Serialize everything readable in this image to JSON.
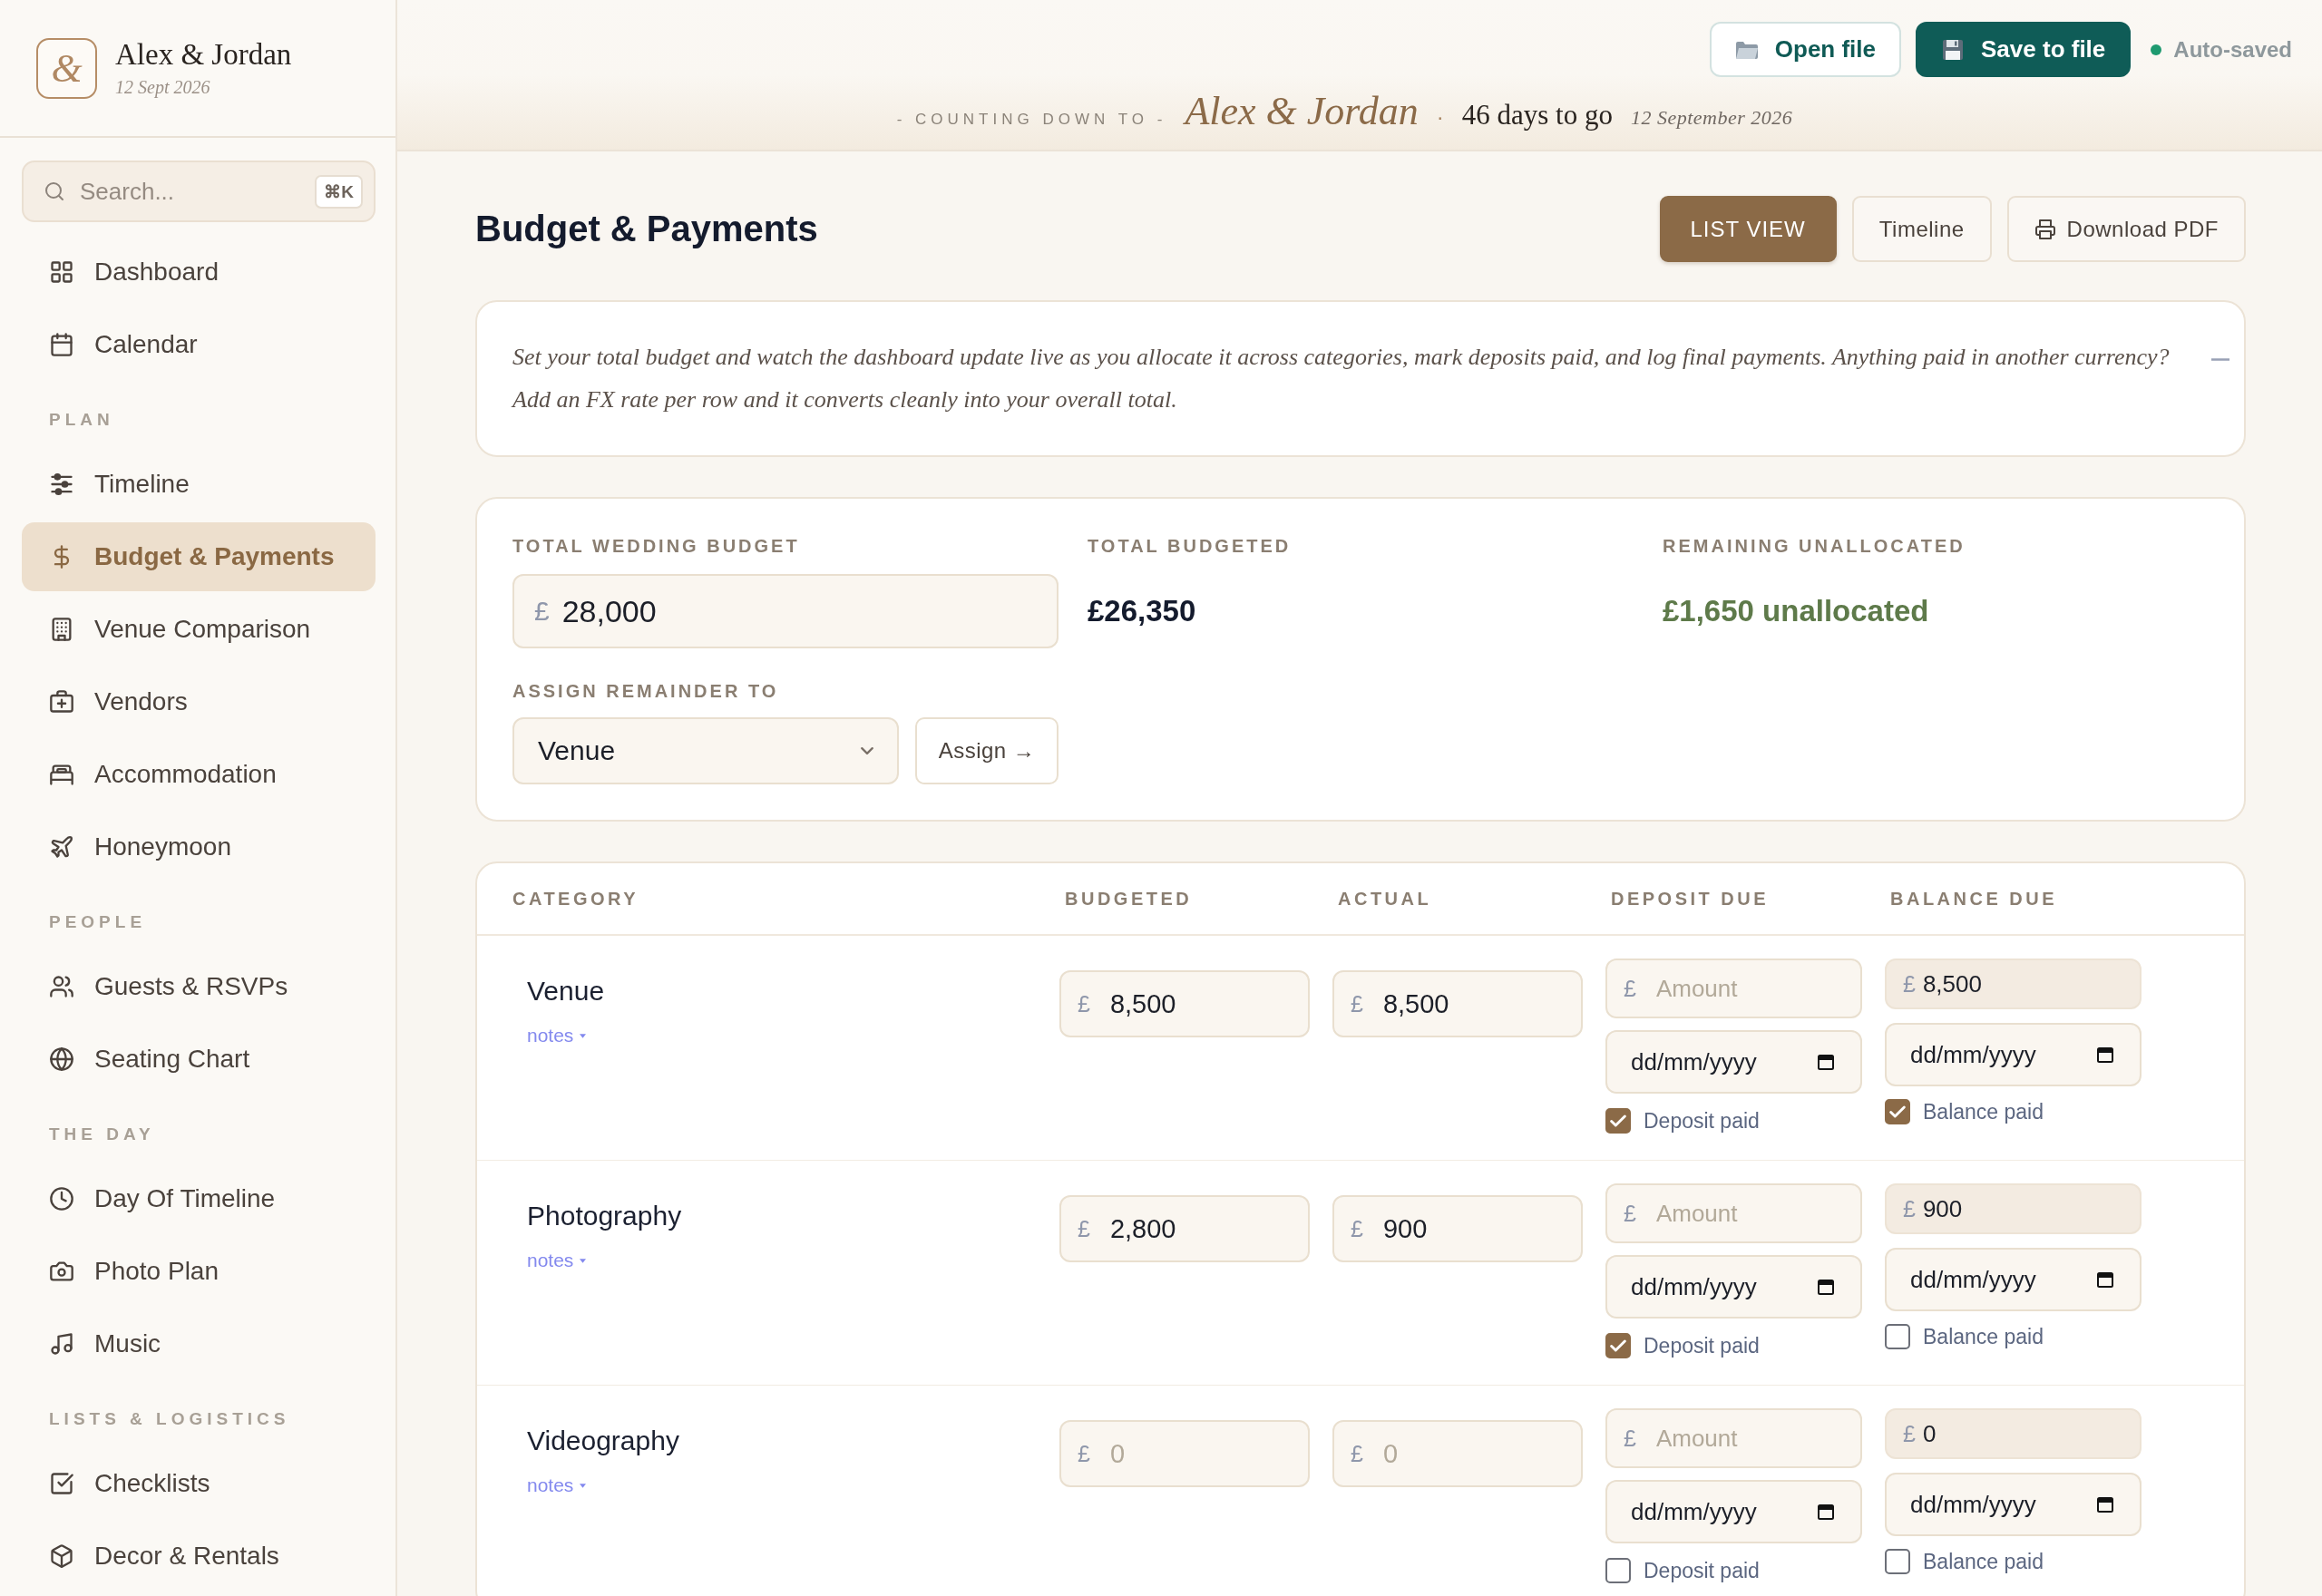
{
  "sidebar": {
    "brand": {
      "monogram": "&",
      "title": "Alex & Jordan",
      "date": "12 Sept 2026"
    },
    "search": {
      "placeholder": "Search...",
      "shortcut": "⌘K"
    },
    "sections": [
      {
        "items": [
          {
            "label": "Dashboard",
            "selected": false
          },
          {
            "label": "Calendar",
            "selected": false
          }
        ]
      },
      {
        "heading": "PLAN",
        "items": [
          {
            "label": "Timeline",
            "selected": false
          },
          {
            "label": "Budget & Payments",
            "selected": true
          },
          {
            "label": "Venue Comparison",
            "selected": false
          },
          {
            "label": "Vendors",
            "selected": false
          },
          {
            "label": "Accommodation",
            "selected": false
          },
          {
            "label": "Honeymoon",
            "selected": false
          }
        ]
      },
      {
        "heading": "PEOPLE",
        "items": [
          {
            "label": "Guests & RSVPs",
            "selected": false
          },
          {
            "label": "Seating Chart",
            "selected": false
          }
        ]
      },
      {
        "heading": "THE DAY",
        "items": [
          {
            "label": "Day Of Timeline",
            "selected": false
          },
          {
            "label": "Photo Plan",
            "selected": false
          },
          {
            "label": "Music",
            "selected": false
          }
        ]
      },
      {
        "heading": "LISTS & LOGISTICS",
        "items": [
          {
            "label": "Checklists",
            "selected": false
          },
          {
            "label": "Decor & Rentals",
            "selected": false
          }
        ]
      }
    ]
  },
  "header": {
    "actions": [
      {
        "label": "Open file",
        "kind": "secondary"
      },
      {
        "label": "Save to file",
        "kind": "primary"
      }
    ],
    "status": "Auto-saved",
    "countdown": {
      "lead": "- COUNTING DOWN TO -",
      "names": "Alex & Jordan",
      "separator": "·",
      "days": "46 days to go",
      "date": "12 September 2026"
    }
  },
  "page": {
    "title": "Budget & Payments",
    "views": [
      {
        "label": "LIST VIEW",
        "selected": true
      },
      {
        "label": "Timeline",
        "selected": false
      }
    ],
    "download": "Download PDF"
  },
  "intro": {
    "text": "Set your total budget and watch the dashboard update live as you allocate it across categories, mark deposits paid, and log final payments. Anything paid in another currency? Add an FX rate per row and it converts cleanly into your overall total.",
    "expanded": true
  },
  "summary": {
    "total_budget": {
      "label": "TOTAL WEDDING BUDGET",
      "currency": "£",
      "value": "28,000"
    },
    "total_budgeted": {
      "label": "TOTAL BUDGETED",
      "value": "£26,350"
    },
    "remaining": {
      "label": "REMAINING UNALLOCATED",
      "value": "£1,650 unallocated"
    },
    "assign": {
      "label": "ASSIGN REMAINDER TO",
      "value": "Venue",
      "button": "Assign →"
    }
  },
  "table": {
    "columns": [
      "CATEGORY",
      "BUDGETED",
      "ACTUAL",
      "DEPOSIT DUE",
      "BALANCE DUE"
    ],
    "rows": [
      {
        "category": "Venue",
        "notes": "notes",
        "budgeted": {
          "currency": "£",
          "value": "8,500",
          "readonly": false
        },
        "actual": {
          "currency": "£",
          "value": "8,500",
          "readonly": false
        },
        "deposit": {
          "amount": {
            "currency": "£",
            "placeholder": "Amount",
            "readonly": false
          },
          "date": {
            "placeholder": "dd/mm/yyyy"
          },
          "paid": {
            "label": "Deposit paid",
            "checked": true
          }
        },
        "balance": {
          "amount": {
            "currency": "£",
            "value": "8,500",
            "readonly": true
          },
          "date": {
            "placeholder": "dd/mm/yyyy"
          },
          "paid": {
            "label": "Balance paid",
            "checked": true
          }
        }
      },
      {
        "category": "Photography",
        "notes": "notes",
        "budgeted": {
          "currency": "£",
          "value": "2,800",
          "readonly": false
        },
        "actual": {
          "currency": "£",
          "value": "900",
          "readonly": false
        },
        "deposit": {
          "amount": {
            "currency": "£",
            "placeholder": "Amount",
            "readonly": false
          },
          "date": {
            "placeholder": "dd/mm/yyyy"
          },
          "paid": {
            "label": "Deposit paid",
            "checked": true
          }
        },
        "balance": {
          "amount": {
            "currency": "£",
            "value": "900",
            "readonly": true
          },
          "date": {
            "placeholder": "dd/mm/yyyy"
          },
          "paid": {
            "label": "Balance paid",
            "checked": false
          }
        }
      },
      {
        "category": "Videography",
        "notes": "notes",
        "budgeted": {
          "currency": "£",
          "placeholder": "0",
          "readonly": false
        },
        "actual": {
          "currency": "£",
          "placeholder": "0",
          "readonly": false
        },
        "deposit": {
          "amount": {
            "currency": "£",
            "placeholder": "Amount",
            "readonly": false
          },
          "date": {
            "placeholder": "dd/mm/yyyy"
          },
          "paid": {
            "label": "Deposit paid",
            "checked": false
          }
        },
        "balance": {
          "amount": {
            "currency": "£",
            "value": "0",
            "readonly": true
          },
          "date": {
            "placeholder": "dd/mm/yyyy"
          },
          "paid": {
            "label": "Balance paid",
            "checked": false
          }
        }
      }
    ]
  }
}
